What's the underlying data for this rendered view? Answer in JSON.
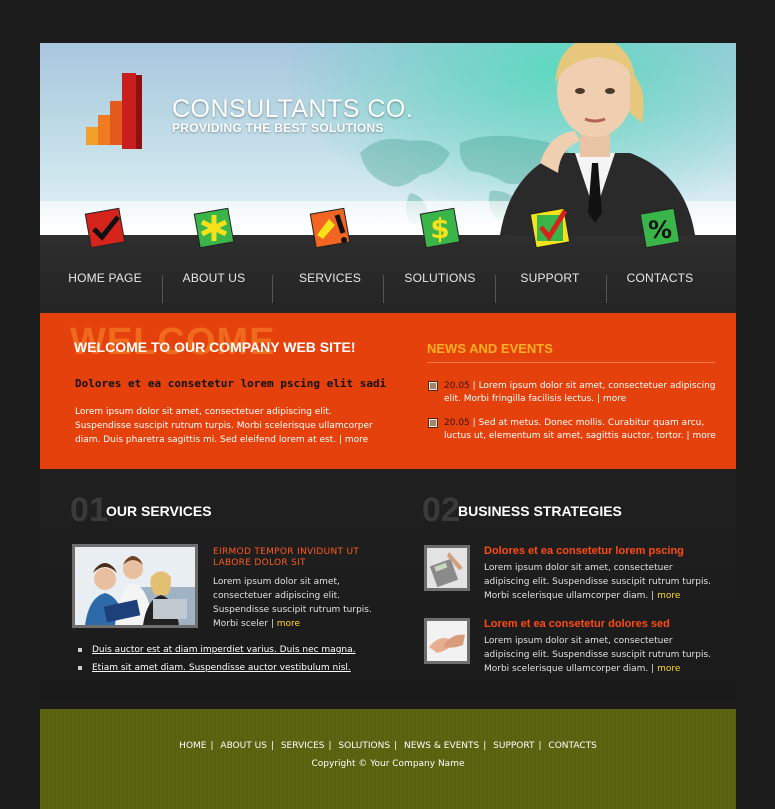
{
  "header": {
    "brand_name": "CONSULTANTS CO.",
    "tagline": "PROVIDING THE BEST SOLUTIONS"
  },
  "nav": {
    "items": [
      {
        "label": "HOME PAGE",
        "icon": "checkmark-icon",
        "color": "#d4241b"
      },
      {
        "label": "ABOUT US",
        "icon": "asterisk-icon",
        "color": "#39b54a"
      },
      {
        "label": "SERVICES",
        "icon": "exclamation-icon",
        "color": "#f26522"
      },
      {
        "label": "SOLUTIONS",
        "icon": "dollar-icon",
        "color": "#39b54a"
      },
      {
        "label": "SUPPORT",
        "icon": "check-pen-icon",
        "color": "#f7e11b"
      },
      {
        "label": "CONTACTS",
        "icon": "percent-icon",
        "color": "#39b54a"
      }
    ]
  },
  "welcome": {
    "ghost_text": "WELCOME",
    "title": "WELCOME TO OUR COMPANY WEB SITE!",
    "subtitle": "Dolores et ea consetetur lorem pscing elit sadi",
    "body": "Lorem ipsum dolor sit amet, consectetuer adipiscing elit. Suspendisse suscipit rutrum turpis. Morbi scelerisque ullamcorper diam. Duis pharetra sagittis mi. Sed eleifend lorem at est.",
    "more": "more"
  },
  "news": {
    "title": "NEWS AND EVENTS",
    "items": [
      {
        "date": "20.05",
        "text": "Lorem ipsum dolor sit amet, consectetuer adipiscing elit. Morbi fringilla facilisis lectus.",
        "more": "more"
      },
      {
        "date": "20.05",
        "text": "Sed at metus. Donec mollis. Curabitur quam arcu, luctus ut, elementum sit amet, sagittis auctor, tortor.",
        "more": "more"
      }
    ]
  },
  "services": {
    "number": "01",
    "title": "OUR SERVICES",
    "subtitle": "EIRMOD TEMPOR INVIDUNT UT LABORE DOLOR SIT",
    "text": "Lorem ipsum dolor sit amet, consectetuer adipiscing elit. Suspendisse suscipit rutrum turpis. Morbi sceler",
    "more": "more",
    "links": [
      "Duis auctor est at diam imperdiet varius. Duis nec magna.",
      "Etiam sit amet diam. Suspendisse auctor vestibulum nisl."
    ]
  },
  "strategies": {
    "number": "02",
    "title": "BUSINESS STRATEGIES",
    "items": [
      {
        "head": "Dolores et ea consetetur lorem pscing",
        "text": "Lorem ipsum dolor sit amet, consectetuer adipiscing elit. Suspendisse suscipit rutrum turpis. Morbi scelerisque ullamcorper diam.",
        "more": "more",
        "thumb": "calculator-image"
      },
      {
        "head": "Lorem et ea consetetur dolores sed",
        "text": "Lorem ipsum dolor sit amet, consectetuer adipiscing elit. Suspendisse suscipit rutrum turpis. Morbi scelerisque ullamcorper diam.",
        "more": "more",
        "thumb": "handshake-image"
      }
    ]
  },
  "footer": {
    "links": [
      "HOME",
      "ABOUT US",
      "SERVICES",
      "SOLUTIONS",
      "NEWS & EVENTS",
      "SUPPORT",
      "CONTACTS"
    ],
    "copyright": "Copyright © Your Company Name"
  }
}
